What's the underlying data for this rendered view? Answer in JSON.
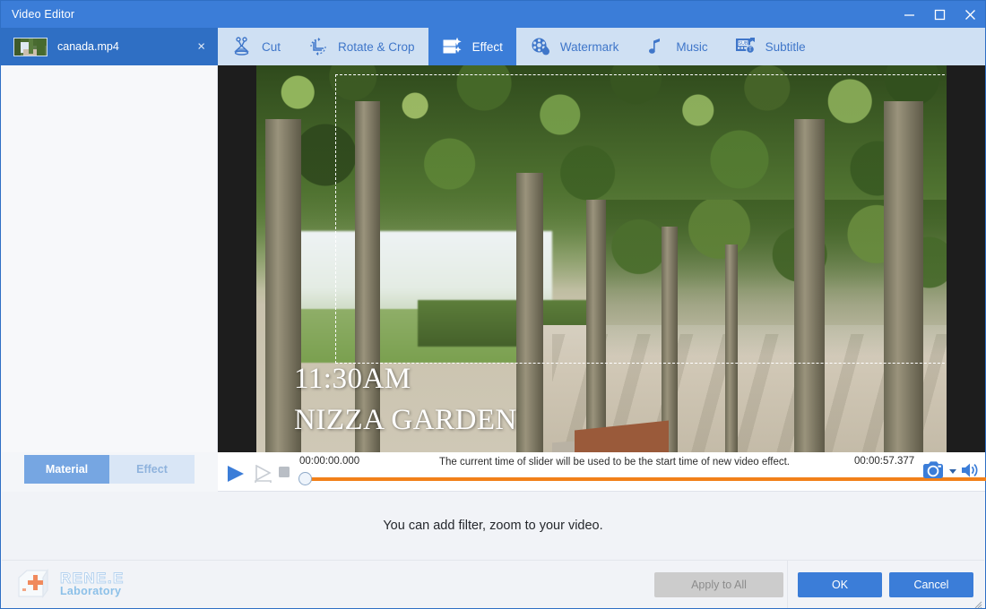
{
  "window": {
    "title": "Video Editor",
    "minimize_icon": "minimize-icon",
    "maximize_icon": "maximize-icon",
    "close_icon": "close-icon"
  },
  "file_tab": {
    "name": "canada.mp4",
    "close_label": "×",
    "thumbnail_icon": "video-thumbnail"
  },
  "toolbar": {
    "tabs": [
      {
        "label": "Cut",
        "icon": "scissors-icon",
        "active": false
      },
      {
        "label": "Rotate & Crop",
        "icon": "rotate-crop-icon",
        "active": false
      },
      {
        "label": "Effect",
        "icon": "film-sparkle-icon",
        "active": true
      },
      {
        "label": "Watermark",
        "icon": "watermark-droplet-icon",
        "active": false
      },
      {
        "label": "Music",
        "icon": "music-note-icon",
        "active": false
      },
      {
        "label": "Subtitle",
        "icon": "subtitle-icon",
        "active": false
      }
    ]
  },
  "left_panel": {
    "tabs": [
      {
        "label": "Material",
        "selected": true
      },
      {
        "label": "Effect",
        "selected": false
      }
    ]
  },
  "preview": {
    "overlay_line1": "11:30AM",
    "overlay_line2": "NIZZA GARDEN",
    "selection_rect": "crop-selection"
  },
  "effect_popup": {
    "chevron": "⌄",
    "buttons": [
      {
        "name": "add-filter-button",
        "icon": "magic-wand-plus-icon"
      },
      {
        "name": "add-zoom-button",
        "icon": "magnifier-plus-icon"
      },
      {
        "name": "add-volume-button",
        "icon": "volume-plus-icon"
      }
    ],
    "highlight_color": "#e8392b"
  },
  "transport": {
    "play_icon": "play-icon",
    "step_icon": "frame-step-icon",
    "stop_icon": "stop-icon",
    "start_time": "00:00:00.000",
    "end_time": "00:00:57.377",
    "hint": "The current time of slider will be used to be the start time of new video effect.",
    "track_color": "#f28019",
    "snapshot_icon": "camera-icon",
    "snapshot_dropdown_icon": "chevron-down-icon",
    "volume_icon": "speaker-icon"
  },
  "info": {
    "text": "You can add filter, zoom to your video."
  },
  "footer": {
    "brand_line1": "RENE.E",
    "brand_line2": "Laboratory",
    "logo_icon": "keycap-plus-logo",
    "apply_all_label": "Apply to All",
    "ok_label": "OK",
    "cancel_label": "Cancel",
    "accent_color": "#3b7dd8"
  }
}
